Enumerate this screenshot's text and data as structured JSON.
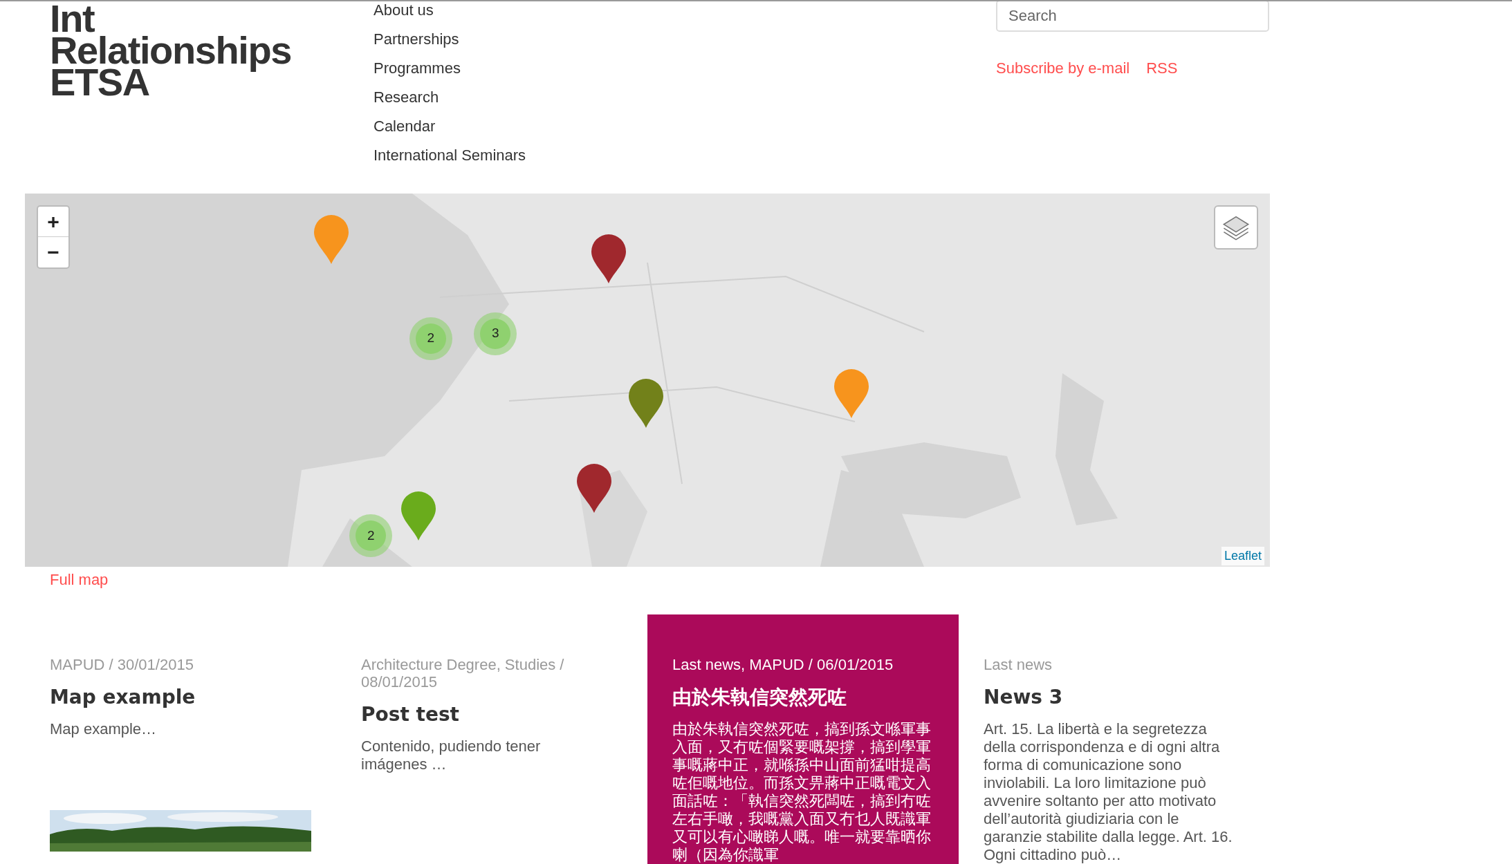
{
  "logo": [
    "Int",
    "Relationships",
    "ETSA"
  ],
  "nav": [
    "About us",
    "Partnerships",
    "Programmes",
    "Research",
    "Calendar",
    "International Seminars"
  ],
  "search": {
    "placeholder": "Search"
  },
  "header_links": [
    "Subscribe by e-mail",
    "RSS"
  ],
  "map": {
    "zoom_in": "+",
    "zoom_out": "−",
    "attribution": "Leaflet",
    "markers": [
      {
        "kind": "pin",
        "color": "#f7941d"
      },
      {
        "kind": "pin",
        "color": "#a0282d"
      },
      {
        "kind": "cluster",
        "count": "2"
      },
      {
        "kind": "cluster",
        "count": "3"
      },
      {
        "kind": "pin",
        "color": "#72811a"
      },
      {
        "kind": "pin",
        "color": "#f7941d"
      },
      {
        "kind": "pin",
        "color": "#a0282d"
      },
      {
        "kind": "pin",
        "color": "#6aac1c"
      },
      {
        "kind": "cluster",
        "count": "2"
      }
    ]
  },
  "full_map_link": "Full map",
  "posts": [
    {
      "meta": "MAPUD / 30/01/2015",
      "title": "Map example",
      "excerpt": "Map example…",
      "highlighted": false
    },
    {
      "meta": "Architecture Degree, Studies / 08/01/2015",
      "title": "Post test",
      "excerpt": "Contenido, pudiendo tener imágenes …",
      "highlighted": false
    },
    {
      "meta": "Last news, MAPUD / 06/01/2015",
      "title": "由於朱執信突然死咗",
      "excerpt": "由於朱執信突然死咗，搞到孫文喺軍事入面，又冇咗個緊要嘅架撐，搞到學軍事嘅蔣中正，就喺孫中山面前猛咁提高咗佢嘅地位。而孫文畀蔣中正嘅電文入面話咗：「執信突然死闆咗，搞到冇咗左右手噉，我嘅黨入面又冇乜人既識軍又可以有心噉睇人嘅。唯一就要靠晒你喇（因為你識軍",
      "highlighted": true
    },
    {
      "meta": "Last news",
      "title": "News 3",
      "excerpt": "Art. 15. La libertà e la segretezza della corrispondenza e di ogni altra forma di comunicazione sono inviolabili. La loro limitazione può avvenire soltanto per atto motivato dell’autorità giudiziaria con le garanzie stabilite dalla legge. Art. 16. Ogni cittadino può…",
      "highlighted": false
    }
  ]
}
